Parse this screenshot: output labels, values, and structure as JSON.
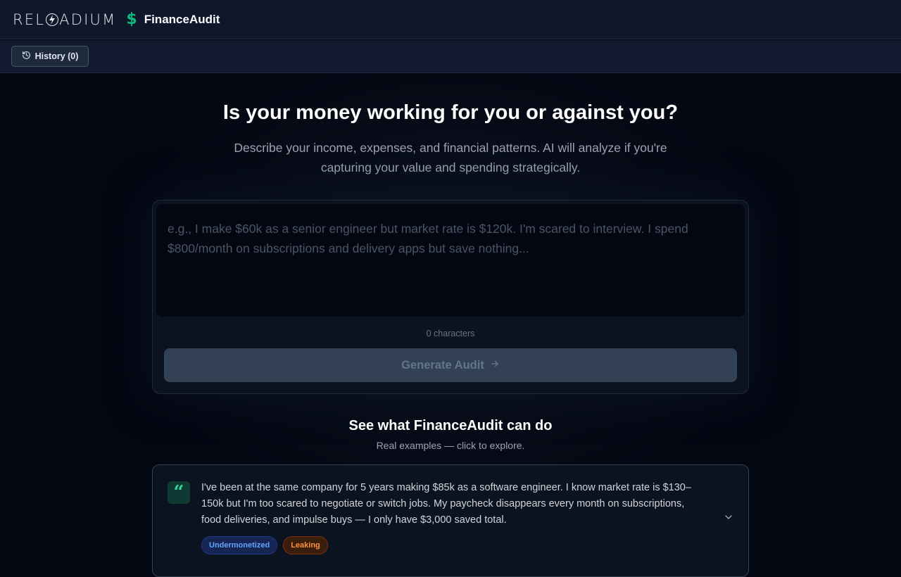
{
  "header": {
    "brand": "RELOADIUM",
    "app_icon": "dollar-icon",
    "app_name": "FinanceAudit"
  },
  "toolbar": {
    "history_label": "History (0)",
    "history_icon": "history-icon"
  },
  "hero": {
    "title": "Is your money working for you or against you?",
    "subtitle": "Describe your income, expenses, and financial patterns. AI will analyze if you're capturing your value and spending strategically."
  },
  "editor": {
    "placeholder": "e.g., I make $60k as a senior engineer but market rate is $120k. I'm scared to interview. I spend $800/month on subscriptions and delivery apps but save nothing...",
    "char_count": "0 characters",
    "generate_label": "Generate Audit"
  },
  "examples": {
    "title": "See what FinanceAudit can do",
    "subtitle": "Real examples — click to explore.",
    "items": [
      {
        "text": "I've been at the same company for 5 years making $85k as a software engineer. I know market rate is $130–150k but I'm too scared to negotiate or switch jobs. My paycheck disappears every month on subscriptions, food deliveries, and impulse buys — I only have $3,000 saved total.",
        "tags": [
          "Undermonetized",
          "Leaking"
        ]
      }
    ]
  },
  "colors": {
    "accent": "#10b981",
    "background": "#030712",
    "tag_blue": "#60a5fa",
    "tag_orange": "#fb923c"
  }
}
